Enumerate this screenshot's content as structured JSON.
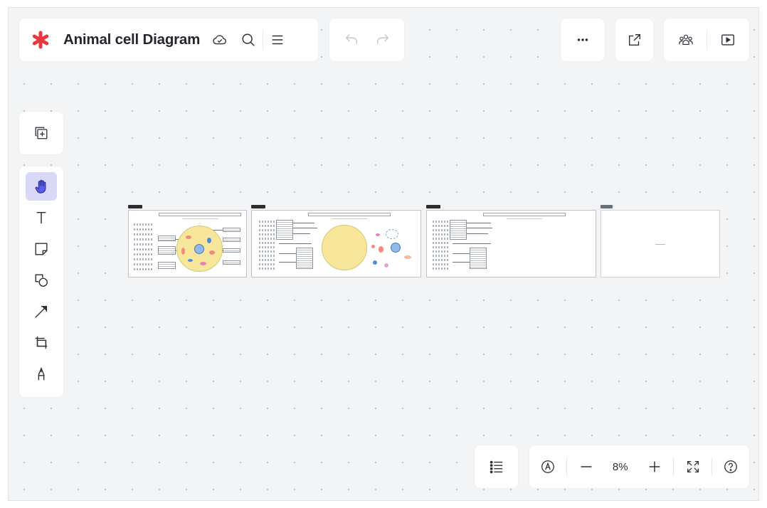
{
  "app": {
    "document_title": "Animal cell Diagram",
    "brand_color": "#e8383d",
    "accent_color": "#3a3ec9"
  },
  "header": {
    "title_icons": [
      "asterisk-logo-icon",
      "cloud-saved-icon",
      "search-icon",
      "menu-icon"
    ],
    "history_icons": [
      "undo-icon",
      "redo-icon"
    ],
    "right_icons": [
      "more-icon",
      "share-icon",
      "collaborators-icon",
      "present-icon"
    ]
  },
  "left_toolbar": {
    "top_icon": "add-page-icon",
    "tools": [
      {
        "name": "hand-tool",
        "icon": "hand-icon",
        "active": true
      },
      {
        "name": "text-tool",
        "icon": "text-icon",
        "active": false
      },
      {
        "name": "sticky-note-tool",
        "icon": "sticky-note-icon",
        "active": false
      },
      {
        "name": "shapes-tool",
        "icon": "shapes-icon",
        "active": false
      },
      {
        "name": "line-tool",
        "icon": "arrow-line-icon",
        "active": false
      },
      {
        "name": "frame-tool",
        "icon": "frame-icon",
        "active": false
      },
      {
        "name": "pen-tool",
        "icon": "pen-icon",
        "active": false
      }
    ]
  },
  "bottom_bar": {
    "zoom_value": "8%",
    "icons": [
      "outline-icon",
      "autosize-icon",
      "zoom-out-icon",
      "zoom-in-icon",
      "fit-to-screen-icon",
      "help-icon"
    ]
  },
  "canvas": {
    "pages": [
      {
        "name": "page-1",
        "tag_color": "#2b2d31"
      },
      {
        "name": "page-2",
        "tag_color": "#2b2d31"
      },
      {
        "name": "page-3",
        "tag_color": "#2b2d31"
      },
      {
        "name": "page-4",
        "tag_color": "#6b6f78"
      }
    ]
  }
}
